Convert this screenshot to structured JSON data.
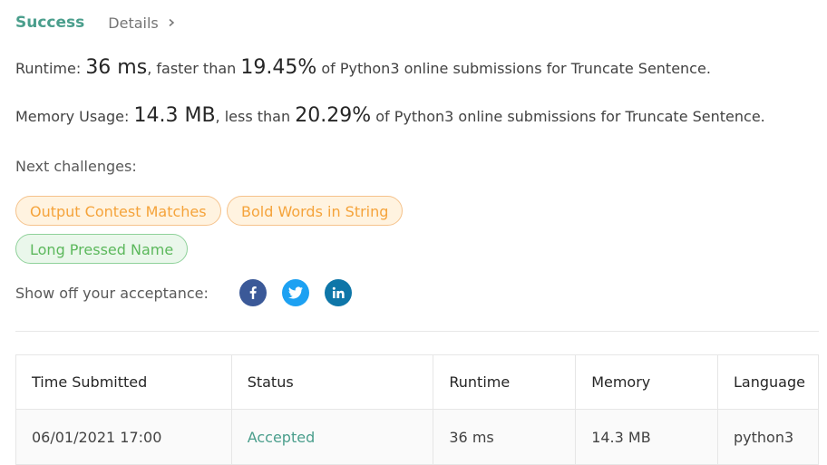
{
  "header": {
    "status": "Success",
    "details_label": "Details"
  },
  "runtime": {
    "label": "Runtime: ",
    "value": "36 ms",
    "middle": ", faster than ",
    "percent": "19.45%",
    "suffix": " of Python3 online submissions for Truncate Sentence."
  },
  "memory": {
    "label": "Memory Usage: ",
    "value": "14.3 MB",
    "middle": ", less than ",
    "percent": "20.29%",
    "suffix": " of Python3 online submissions for Truncate Sentence."
  },
  "next_challenges": {
    "label": "Next challenges:",
    "items": [
      {
        "title": "Output Contest Matches",
        "difficulty": "medium"
      },
      {
        "title": "Bold Words in String",
        "difficulty": "medium"
      },
      {
        "title": "Long Pressed Name",
        "difficulty": "easy"
      }
    ]
  },
  "share": {
    "label": "Show off your acceptance:",
    "icons": [
      {
        "name": "facebook-icon",
        "color": "#3b5998"
      },
      {
        "name": "twitter-icon",
        "color": "#1da1f2"
      },
      {
        "name": "linkedin-icon",
        "color": "#0e76a8"
      }
    ]
  },
  "colors": {
    "accent": "#4a9e8c",
    "medium_tag": "#f5a33a",
    "easy_tag": "#5cb85c"
  },
  "table": {
    "headers": [
      "Time Submitted",
      "Status",
      "Runtime",
      "Memory",
      "Language"
    ],
    "rows": [
      {
        "time": "06/01/2021 17:00",
        "status": "Accepted",
        "runtime": "36 ms",
        "memory": "14.3 MB",
        "language": "python3"
      }
    ]
  }
}
